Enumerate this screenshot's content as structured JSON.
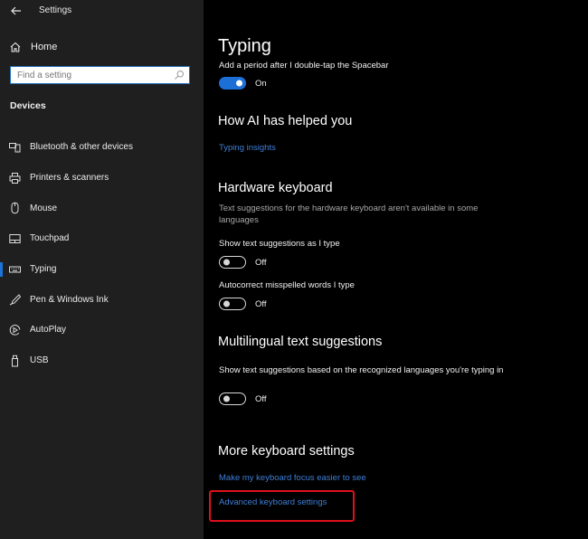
{
  "window": {
    "title": "Settings"
  },
  "sidebar": {
    "home_label": "Home",
    "search": {
      "placeholder": "Find a setting",
      "value": ""
    },
    "section_title": "Devices",
    "items": [
      {
        "label": "Bluetooth & other devices",
        "icon": "bluetooth-devices-icon",
        "selected": false
      },
      {
        "label": "Printers & scanners",
        "icon": "printer-icon",
        "selected": false
      },
      {
        "label": "Mouse",
        "icon": "mouse-icon",
        "selected": false
      },
      {
        "label": "Touchpad",
        "icon": "touchpad-icon",
        "selected": false
      },
      {
        "label": "Typing",
        "icon": "keyboard-icon",
        "selected": true
      },
      {
        "label": "Pen & Windows Ink",
        "icon": "pen-icon",
        "selected": false
      },
      {
        "label": "AutoPlay",
        "icon": "autoplay-icon",
        "selected": false
      },
      {
        "label": "USB",
        "icon": "usb-icon",
        "selected": false
      }
    ]
  },
  "main": {
    "page_title": "Typing",
    "period_setting": {
      "label": "Add a period after I double-tap the Spacebar",
      "state": "On",
      "enabled": true
    },
    "ai_section": {
      "title": "How AI has helped you",
      "link": "Typing insights"
    },
    "hardware_section": {
      "title": "Hardware keyboard",
      "description": "Text suggestions for the hardware keyboard aren't available in some languages",
      "settings": [
        {
          "label": "Show text suggestions as I type",
          "state": "Off",
          "enabled": false
        },
        {
          "label": "Autocorrect misspelled words I type",
          "state": "Off",
          "enabled": false
        }
      ]
    },
    "multilingual_section": {
      "title": "Multilingual text suggestions",
      "setting": {
        "label": "Show text suggestions based on the recognized languages you're typing in",
        "state": "Off",
        "enabled": false
      }
    },
    "more_section": {
      "title": "More keyboard settings",
      "links": [
        "Make my keyboard focus easier to see",
        "Advanced keyboard settings"
      ]
    }
  },
  "colors": {
    "accent": "#1c6fd6",
    "link": "#3f7fd6",
    "highlight": "#e0101a",
    "sidebar_bg": "#1f1f1f",
    "main_bg": "#000000"
  }
}
